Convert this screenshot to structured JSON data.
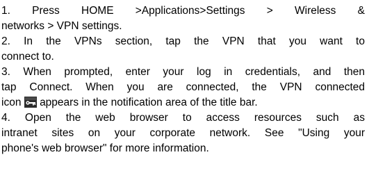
{
  "steps": [
    {
      "line1": "1. Press HOME >Applications>Settings > Wireless &",
      "line2": "networks > VPN settings."
    },
    {
      "line1": "2. In the VPNs section, tap the VPN that you want to",
      "line2": "connect to."
    },
    {
      "line1": "3. When prompted, enter your log in credentials, and then",
      "line2": "tap Connect. When you are connected, the VPN connected",
      "line3a": "icon",
      "line3b": "appears in the notification area of the title bar."
    },
    {
      "line1": "4. Open the web browser to access resources such as",
      "line2": "intranet sites on your corporate network. See \"Using your",
      "line3": "phone's web browser\" for more information."
    }
  ],
  "icons": {
    "vpn_connected": "vpn-connected-icon"
  }
}
